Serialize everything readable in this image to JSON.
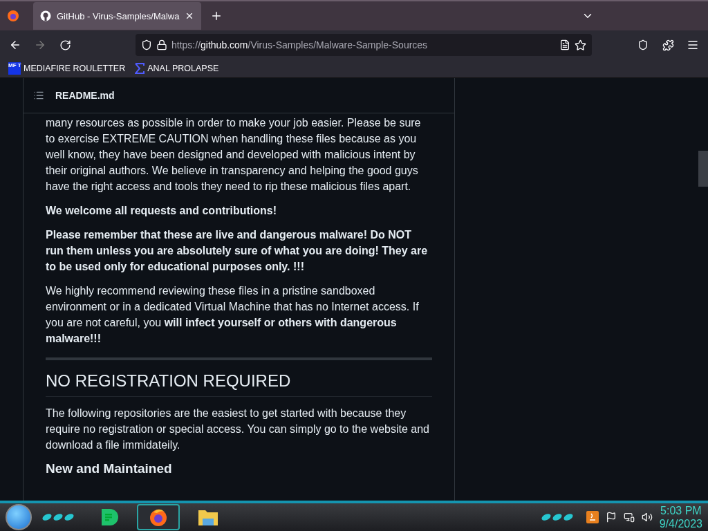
{
  "browser": {
    "tabs": [
      {
        "title": "GitHub - Virus-Samples/Malwa",
        "selected": true
      }
    ],
    "url": {
      "scheme": "https://",
      "host": "github.com",
      "path": "/Virus-Samples/Malware-Sample-Sources"
    },
    "bookmarks": [
      {
        "label": "MEDIAFIRE ROULETTER",
        "icon_text": "MF T"
      },
      {
        "label": "ANAL PROLAPSE"
      }
    ]
  },
  "readme": {
    "title": "README.md",
    "blocks": [
      {
        "kind": "paragraph",
        "text": "many resources as possible in order to make your job easier. Please be sure to exercise EXTREME CAUTION when handling these files because as you well know, they have been designed and developed with malicious intent by their original authors. We believe in transparency and helping the good guys have the right access and tools they need to rip these malicious files apart."
      },
      {
        "kind": "paragraph",
        "text": "**We welcome all requests and contributions!**"
      },
      {
        "kind": "paragraph",
        "text": "**Please remember that these are live and dangerous malware! Do NOT run them unless you are absolutely sure of what you are doing! They are to be used only for educational purposes only. !!!**"
      },
      {
        "kind": "paragraph",
        "text": "We highly recommend reviewing these files in a pristine sandboxed environment or in a dedicated Virtual Machine that has no Internet access. If you are not careful, you **will infect yourself or others with dangerous malware!!!**"
      },
      {
        "kind": "rule"
      },
      {
        "kind": "heading",
        "text": "NO REGISTRATION REQUIRED"
      },
      {
        "kind": "paragraph",
        "text": "The following repositories are the easiest to get started with because they require no registration or special access. You can simply go to the website and download a file immidateily."
      },
      {
        "kind": "subheading",
        "text": "New and Maintained"
      }
    ]
  },
  "taskbar": {
    "apps": [
      {
        "kind": "chat",
        "selected": false
      },
      {
        "kind": "firefox",
        "selected": true
      },
      {
        "kind": "folder",
        "selected": false
      }
    ],
    "time": "5:03 PM",
    "date": "9/4/2023"
  }
}
